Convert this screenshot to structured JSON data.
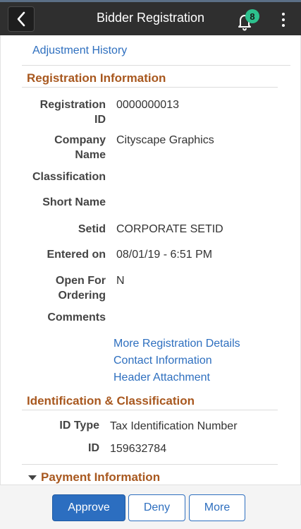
{
  "header": {
    "title": "Bidder Registration",
    "notification_count": "8"
  },
  "links": {
    "adjustment_history": "Adjustment History"
  },
  "registration": {
    "title": "Registration Information",
    "fields": [
      {
        "label_line1": "Registration",
        "label_line2": "ID",
        "value": "0000000013"
      },
      {
        "label_line1": "Company",
        "label_line2": "Name",
        "value": "Cityscape Graphics"
      },
      {
        "label": "Classification",
        "value": ""
      },
      {
        "label": "Short Name",
        "value": ""
      },
      {
        "label": "Setid",
        "value": "CORPORATE SETID"
      },
      {
        "label": "Entered on",
        "value": "08/01/19 - 6:51 PM"
      },
      {
        "label_line1": "Open For",
        "label_line2": "Ordering",
        "value": "N"
      },
      {
        "label": "Comments",
        "value": ""
      }
    ],
    "links": [
      "More Registration Details",
      "Contact Information",
      "Header Attachment"
    ]
  },
  "identification": {
    "title": "Identification & Classification",
    "fields": [
      {
        "label": "ID Type",
        "value": "Tax Identification Number"
      },
      {
        "label": "ID",
        "value": "159632784"
      }
    ]
  },
  "payment": {
    "title": "Payment Information"
  },
  "footer": {
    "approve": "Approve",
    "deny": "Deny",
    "more": "More"
  },
  "colors": {
    "header_bg": "#2f2f2f",
    "section_title": "#a8581f",
    "link": "#2e6fbf",
    "primary": "#2c6ec0",
    "badge": "#2dc08d"
  }
}
